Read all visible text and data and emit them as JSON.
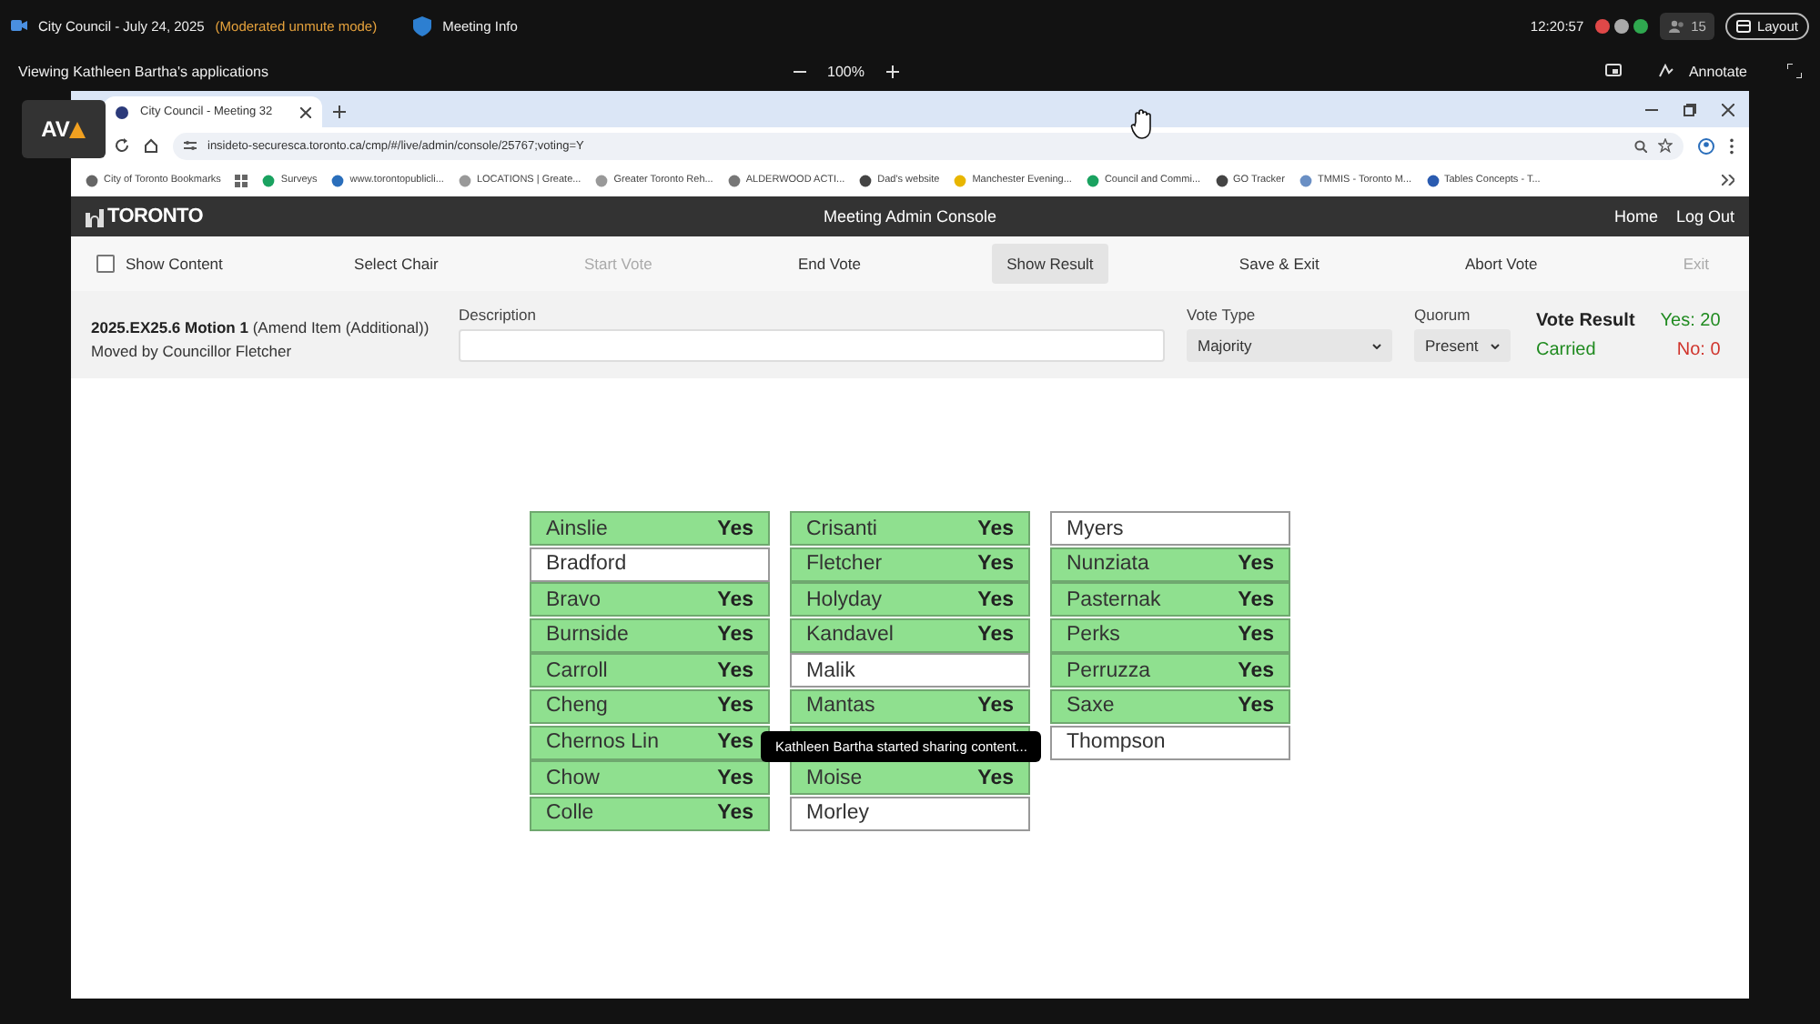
{
  "meeting_bar": {
    "title": "City Council - July 24, 2025",
    "mode": "(Moderated unmute mode)",
    "info": "Meeting Info",
    "time": "12:20:57",
    "participants": "15",
    "layout": "Layout"
  },
  "view_bar": {
    "viewing": "Viewing Kathleen Bartha's applications",
    "zoom": "100%",
    "annotate": "Annotate"
  },
  "browser": {
    "tab_title": "City Council - Meeting 32",
    "url": "insideto-securesca.toronto.ca/cmp/#/live/admin/console/25767;voting=Y",
    "bookmarks": [
      {
        "label": "City of Toronto Bookmarks",
        "color": "#666666"
      },
      {
        "label": "Surveys",
        "color": "#1aa260"
      },
      {
        "label": "www.torontopublicli...",
        "color": "#2a6ebb"
      },
      {
        "label": "LOCATIONS | Greate...",
        "color": "#999999"
      },
      {
        "label": "Greater Toronto Reh...",
        "color": "#999999"
      },
      {
        "label": "ALDERWOOD ACTI...",
        "color": "#777777"
      },
      {
        "label": "Dad's website",
        "color": "#444444"
      },
      {
        "label": "Manchester Evening...",
        "color": "#e8b600"
      },
      {
        "label": "Council and Commi...",
        "color": "#1aa260"
      },
      {
        "label": "GO Tracker",
        "color": "#444444"
      },
      {
        "label": "TMMIS - Toronto M...",
        "color": "#6a8fc4"
      },
      {
        "label": "Tables Concepts - T...",
        "color": "#2a5bb0"
      }
    ]
  },
  "app": {
    "logo": "TORONTO",
    "title": "Meeting Admin Console",
    "nav": [
      "Home",
      "Log Out"
    ]
  },
  "toolbar": {
    "show_content": {
      "label": "Show Content",
      "checked": false
    },
    "actions": [
      {
        "label": "Select Chair",
        "disabled": false,
        "selected": false
      },
      {
        "label": "Start Vote",
        "disabled": true,
        "selected": false
      },
      {
        "label": "End Vote",
        "disabled": false,
        "selected": false
      },
      {
        "label": "Show Result",
        "disabled": false,
        "selected": true
      },
      {
        "label": "Save & Exit",
        "disabled": false,
        "selected": false
      },
      {
        "label": "Abort Vote",
        "disabled": false,
        "selected": false
      },
      {
        "label": "Exit",
        "disabled": true,
        "selected": false
      }
    ]
  },
  "motion": {
    "id": "2025.EX25.6 Motion 1",
    "type": "(Amend Item (Additional))",
    "mover": "Moved by Councillor Fletcher"
  },
  "description": {
    "label": "Description"
  },
  "vote_type": {
    "label": "Vote Type",
    "value": "Majority"
  },
  "quorum": {
    "label": "Quorum",
    "value": "Present"
  },
  "result": {
    "label": "Vote Result",
    "outcome": "Carried",
    "yes": "Yes: 20",
    "no": "No: 0"
  },
  "members": [
    [
      {
        "name": "Ainslie",
        "vote": "Yes",
        "voted": true
      },
      {
        "name": "Bradford",
        "voted": false
      },
      {
        "name": "Bravo",
        "vote": "Yes",
        "voted": true
      },
      {
        "name": "Burnside",
        "vote": "Yes",
        "voted": true
      },
      {
        "name": "Carroll",
        "vote": "Yes",
        "voted": true
      },
      {
        "name": "Cheng",
        "vote": "Yes",
        "voted": true
      },
      {
        "name": "Chernos Lin",
        "vote": "Yes",
        "voted": true
      },
      {
        "name": "Chow",
        "vote": "Yes",
        "voted": true
      },
      {
        "name": "Colle",
        "vote": "Yes",
        "voted": true
      }
    ],
    [
      {
        "name": "Crisanti",
        "vote": "Yes",
        "voted": true
      },
      {
        "name": "Fletcher",
        "vote": "Yes",
        "voted": true
      },
      {
        "name": "Holyday",
        "vote": "Yes",
        "voted": true
      },
      {
        "name": "Kandavel",
        "vote": "Yes",
        "voted": true
      },
      {
        "name": "Malik",
        "voted": false
      },
      {
        "name": "Mantas",
        "vote": "Yes",
        "voted": true
      },
      {
        "voted": true
      },
      {
        "name": "Moise",
        "vote": "Yes",
        "voted": true
      },
      {
        "name": "Morley",
        "voted": false
      }
    ],
    [
      {
        "name": "Myers",
        "voted": false
      },
      {
        "name": "Nunziata",
        "vote": "Yes",
        "voted": true
      },
      {
        "name": "Pasternak",
        "vote": "Yes",
        "voted": true
      },
      {
        "name": "Perks",
        "vote": "Yes",
        "voted": true
      },
      {
        "name": "Perruzza",
        "vote": "Yes",
        "voted": true
      },
      {
        "name": "Saxe",
        "vote": "Yes",
        "voted": true
      },
      {
        "name": "Thompson",
        "voted": false
      }
    ]
  ],
  "toast": "Kathleen Bartha started sharing content...",
  "overlay_logo": "AV"
}
